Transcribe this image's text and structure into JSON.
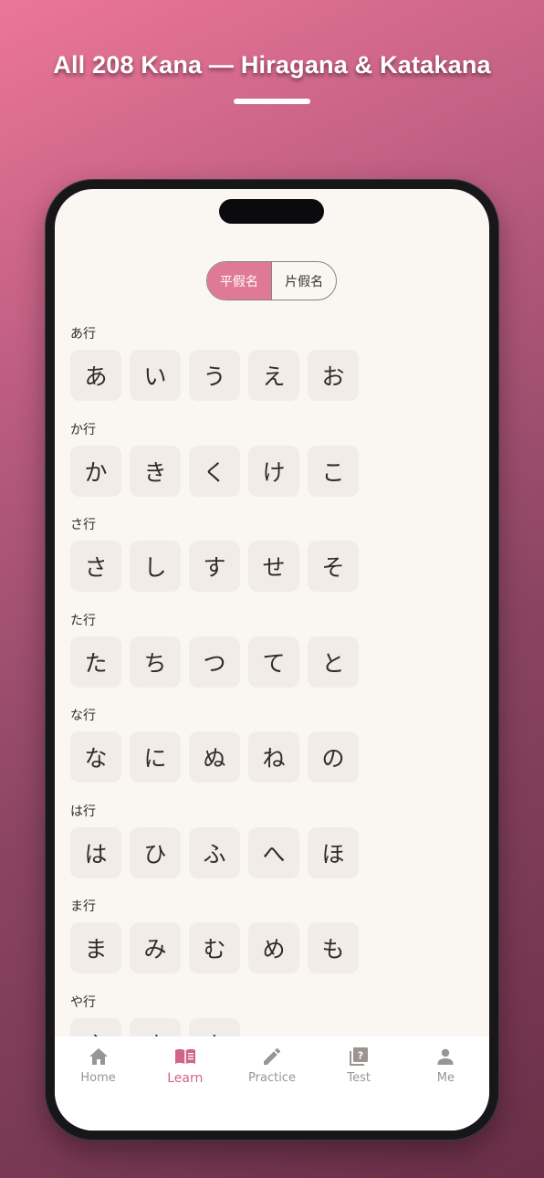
{
  "headline": "All 208 Kana — Hiragana & Katakana",
  "segment": {
    "hiragana": "平假名",
    "katakana": "片假名",
    "selected": "hiragana"
  },
  "rows": [
    {
      "label": "あ行",
      "kana": [
        "あ",
        "い",
        "う",
        "え",
        "お"
      ]
    },
    {
      "label": "か行",
      "kana": [
        "か",
        "き",
        "く",
        "け",
        "こ"
      ]
    },
    {
      "label": "さ行",
      "kana": [
        "さ",
        "し",
        "す",
        "せ",
        "そ"
      ]
    },
    {
      "label": "た行",
      "kana": [
        "た",
        "ち",
        "つ",
        "て",
        "と"
      ]
    },
    {
      "label": "な行",
      "kana": [
        "な",
        "に",
        "ぬ",
        "ね",
        "の"
      ]
    },
    {
      "label": "は行",
      "kana": [
        "は",
        "ひ",
        "ふ",
        "へ",
        "ほ"
      ]
    },
    {
      "label": "ま行",
      "kana": [
        "ま",
        "み",
        "む",
        "め",
        "も"
      ]
    },
    {
      "label": "や行",
      "kana": [
        "や",
        "ゆ",
        "よ"
      ]
    }
  ],
  "tabs": [
    {
      "label": "Home",
      "icon": "home-icon"
    },
    {
      "label": "Learn",
      "icon": "book-icon",
      "active": true
    },
    {
      "label": "Practice",
      "icon": "pencil-icon"
    },
    {
      "label": "Test",
      "icon": "quiz-icon"
    },
    {
      "label": "Me",
      "icon": "person-icon"
    }
  ],
  "colors": {
    "accent": "#df7a95",
    "active_tab": "#cf6686",
    "inactive_tab": "#9a9492"
  }
}
